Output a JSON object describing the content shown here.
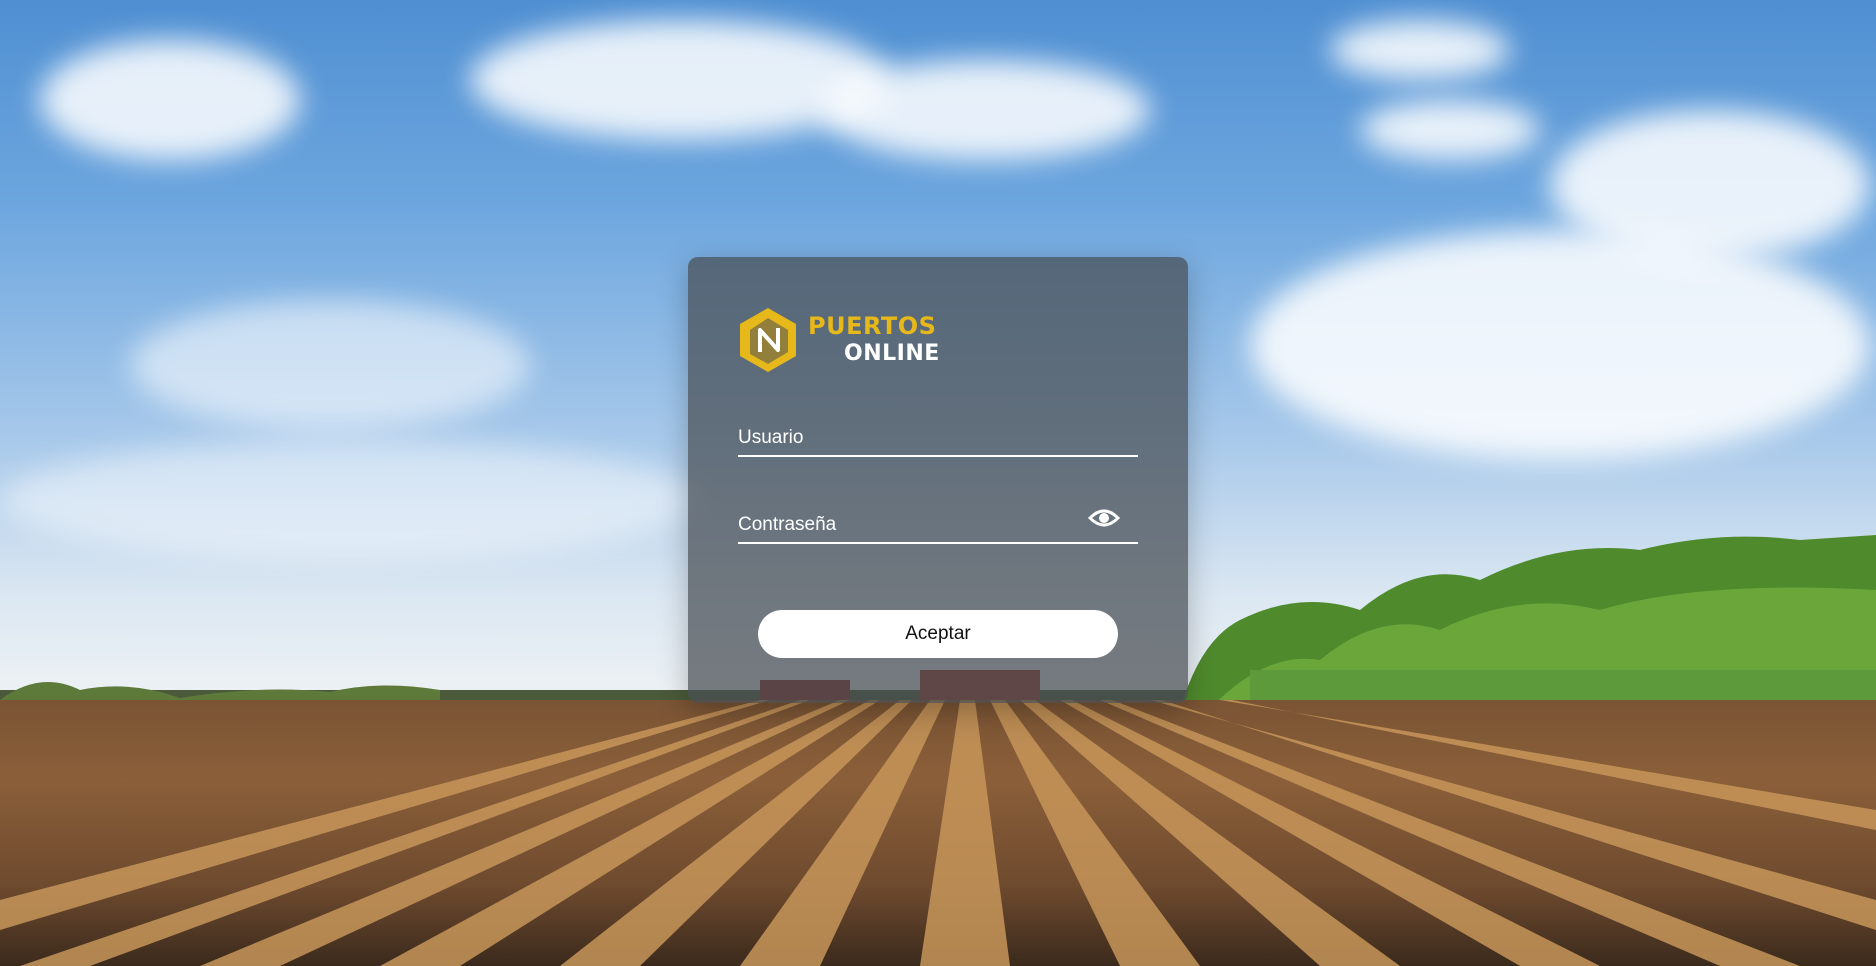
{
  "brand": {
    "line1": "PUERTOS",
    "line2": "ONLINE",
    "accent_color": "#e7b81a",
    "logo_icon": "hexagon-n-logo"
  },
  "login": {
    "username_placeholder": "Usuario",
    "password_placeholder": "Contraseña",
    "show_password_icon": "eye-icon",
    "submit_label": "Aceptar"
  }
}
